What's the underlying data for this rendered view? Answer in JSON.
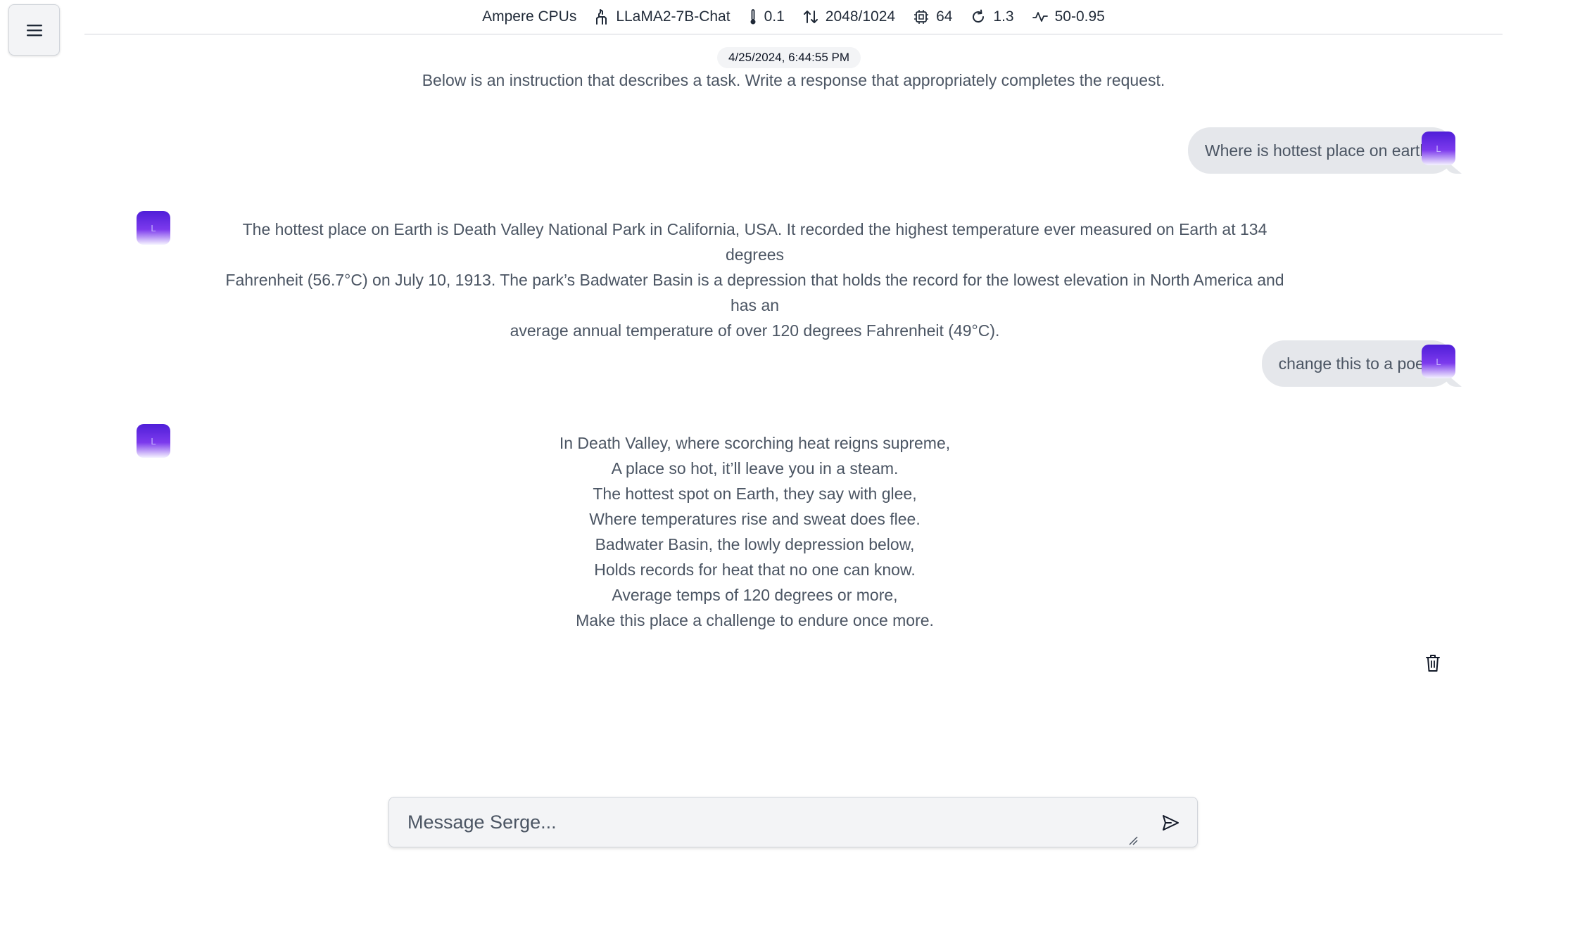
{
  "header": {
    "hardware": "Ampere CPUs",
    "model": "LLaMA2-7B-Chat",
    "temperature": "0.1",
    "context": "2048/1024",
    "threads": "64",
    "repeat_penalty": "1.3",
    "top_k_p": "50-0.95"
  },
  "chat": {
    "timestamp": "4/25/2024, 6:44:55 PM",
    "instruction": "Below is an instruction that describes a task. Write a response that appropriately completes the request.",
    "avatar_letter": "L",
    "messages": [
      {
        "role": "user",
        "text": "Where is hottest place on earth?"
      },
      {
        "role": "assistant",
        "lines": [
          "The hottest place on Earth is Death Valley National Park in California, USA. It recorded the highest temperature ever measured on Earth at 134 degrees",
          "Fahrenheit (56.7°C) on July 10, 1913. The park’s Badwater Basin is a depression that holds the record for the lowest elevation in North America and has an",
          "average annual temperature of over 120 degrees Fahrenheit (49°C)."
        ]
      },
      {
        "role": "user",
        "text": "change this to a poem"
      },
      {
        "role": "assistant",
        "lines": [
          "In Death Valley, where scorching heat reigns supreme,",
          "A place so hot, it’ll leave you in a steam.",
          "The hottest spot on Earth, they say with glee,",
          "Where temperatures rise and sweat does flee.",
          "Badwater Basin, the lowly depression below,",
          "Holds records for heat that no one can know.",
          "Average temps of 120 degrees or more,",
          "Make this place a challenge to endure once more."
        ]
      }
    ]
  },
  "composer": {
    "placeholder": "Message Serge..."
  },
  "icons": {
    "menu": "hamburger-menu-icon",
    "model": "llama-icon",
    "temperature": "thermometer-icon",
    "context": "arrows-up-down-icon",
    "threads": "cpu-chip-icon",
    "repeat_penalty": "refresh-icon",
    "top_k_p": "activity-icon",
    "delete": "trash-icon",
    "send": "send-icon"
  },
  "colors": {
    "avatar_gradient_start": "#4f1ed8",
    "avatar_gradient_end": "#f5f3ff",
    "bubble": "#e5e7eb",
    "text": "#4b5563"
  }
}
